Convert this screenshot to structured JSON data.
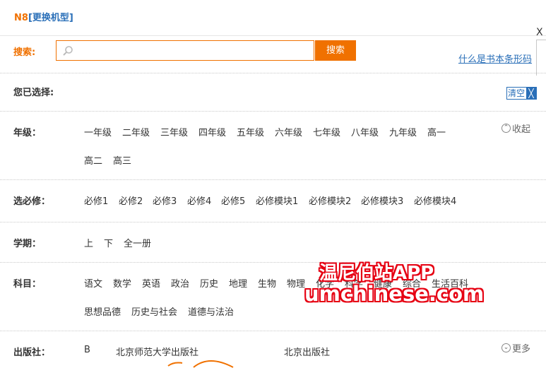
{
  "header": {
    "model": "N8",
    "change_label": "[更换机型]"
  },
  "search": {
    "label": "搜索:",
    "value": "",
    "placeholder": "",
    "button_label": "搜索"
  },
  "ad": {
    "close_label": "X",
    "isbn_link": "什么是书本条形码"
  },
  "selected": {
    "label": "您已选择:",
    "clear_label": "清空",
    "clear_x": "╳"
  },
  "grade": {
    "label": "年级：",
    "options": [
      "一年级",
      "二年级",
      "三年级",
      "四年级",
      "五年级",
      "六年级",
      "七年级",
      "八年级",
      "九年级",
      "高一",
      "高二",
      "高三"
    ],
    "toggle_label": "收起",
    "toggle_icon": "⌃"
  },
  "required": {
    "label": "选必修：",
    "options": [
      "必修1",
      "必修2",
      "必修3",
      "必修4",
      "必修5",
      "必修模块1",
      "必修模块2",
      "必修模块3",
      "必修模块4"
    ]
  },
  "term": {
    "label": "学期：",
    "options": [
      "上",
      "下",
      "全一册"
    ]
  },
  "subject": {
    "label": "科目：",
    "options": [
      "语文",
      "数学",
      "英语",
      "政治",
      "历史",
      "地理",
      "生物",
      "物理",
      "化学",
      "科学",
      "健康",
      "综合",
      "生活百科",
      "思想品德",
      "历史与社会",
      "道德与法治"
    ]
  },
  "publisher": {
    "label": "出版社：",
    "options": [
      "B",
      "北京师范大学出版社",
      "北京出版社"
    ],
    "toggle_label": "更多",
    "toggle_icon": "⌄"
  },
  "watermark": {
    "line1": "温尼伯站APP",
    "line2": "umchinese.com"
  },
  "colors": {
    "accent": "#f07100",
    "link": "#2a6fb8",
    "watermark": "#e60012"
  }
}
